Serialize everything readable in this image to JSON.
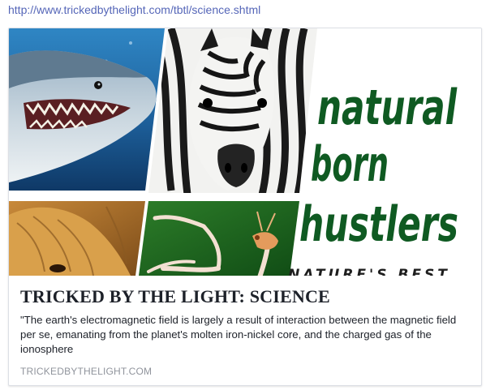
{
  "link_url": "http://www.trickedbythelight.com/tbtl/science.shtml",
  "card": {
    "image": {
      "title_lines": [
        "natural",
        "born",
        "hustlers"
      ],
      "tagline": "NATURE'S BEST",
      "title_color": "#0f5a22"
    },
    "headline": "TRICKED BY THE LIGHT: SCIENCE",
    "description": "\"The earth's electromagnetic field is largely a result of interaction between the magnetic field per se, emanating from the planet's molten iron-nickel core, and the charged gas of the ionosphere",
    "domain": "TRICKEDBYTHELIGHT.COM"
  },
  "colors": {
    "link": "#5566b8",
    "headline_text": "#1d2129",
    "domain_text": "#90949c",
    "card_border": "#dcdfe5"
  }
}
